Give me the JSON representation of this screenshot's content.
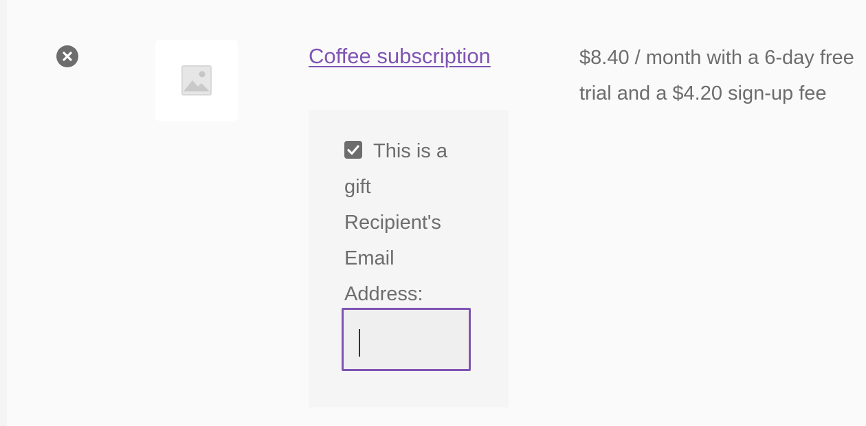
{
  "cart_item": {
    "remove_icon": "close-circle-icon",
    "thumbnail_icon": "image-placeholder-icon",
    "product_name": "Coffee subscription",
    "price_text": "$8.40 / month with a 6-day free trial and a $4.20 sign-up fee",
    "gift": {
      "checkbox_checked": true,
      "checkbox_label": "This is a gift",
      "email_label": "Recipient's Email Address:",
      "email_value": ""
    }
  },
  "colors": {
    "link": "#7f54b3",
    "text": "#6d6d6d",
    "input_border": "#7f54b3"
  }
}
